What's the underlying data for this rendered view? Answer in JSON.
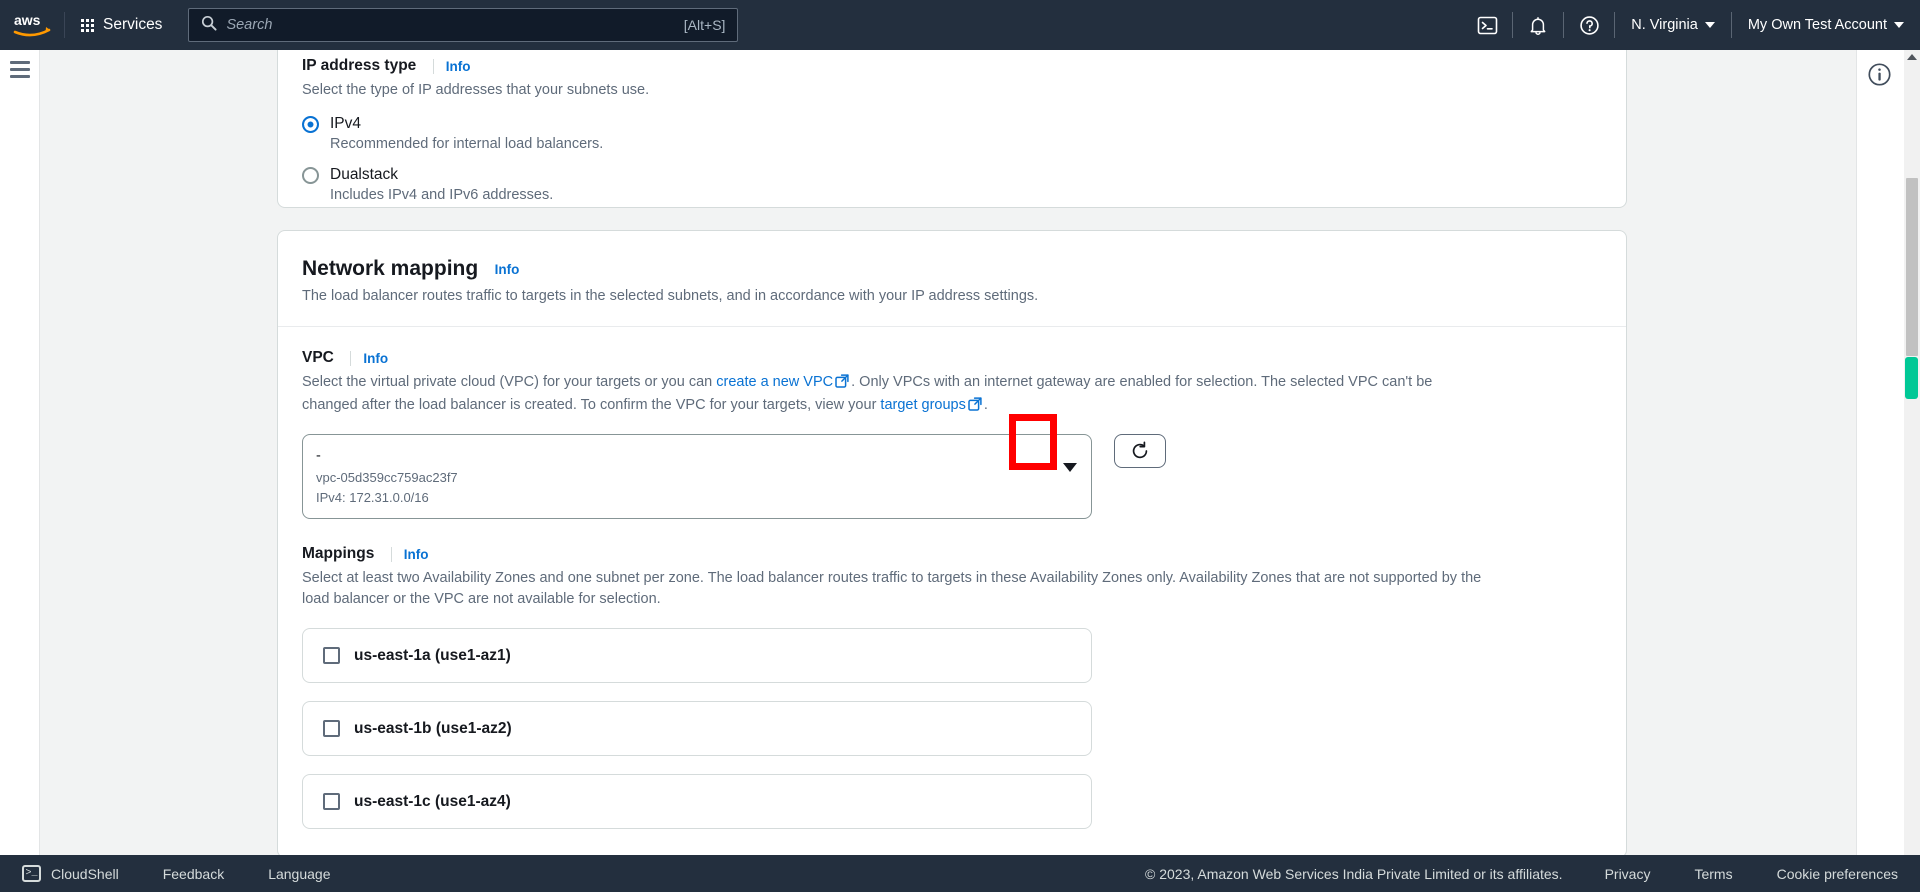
{
  "topnav": {
    "logo_alt": "aws",
    "services_label": "Services",
    "search_placeholder": "Search",
    "search_value": "",
    "search_shortcut": "[Alt+S]",
    "cloudshell_icon": "cloudshell-icon",
    "bell_icon": "notifications-icon",
    "help_icon": "help-icon",
    "region_label": "N. Virginia",
    "account_label": "My Own Test Account"
  },
  "ip_address_type": {
    "label": "IP address type",
    "info": "Info",
    "description": "Select the type of IP addresses that your subnets use.",
    "options": [
      {
        "label": "IPv4",
        "sub": "Recommended for internal load balancers.",
        "selected": true
      },
      {
        "label": "Dualstack",
        "sub": "Includes IPv4 and IPv6 addresses.",
        "selected": false
      }
    ]
  },
  "network_mapping": {
    "title": "Network mapping",
    "info": "Info",
    "description": "The load balancer routes traffic to targets in the selected subnets, and in accordance with your IP address settings.",
    "vpc": {
      "label": "VPC",
      "info": "Info",
      "desc_part1": "Select the virtual private cloud (VPC) for your targets or you can ",
      "desc_link1": "create a new VPC",
      "desc_part2": ". Only VPCs with an internet gateway are enabled for selection. The selected VPC can't be changed after the load balancer is created. To confirm the VPC for your targets, view your ",
      "desc_link2": "target groups",
      "desc_part3": ".",
      "selected_name": "-",
      "selected_id": "vpc-05d359cc759ac23f7",
      "selected_cidr": "IPv4: 172.31.0.0/16",
      "refresh_icon": "refresh-icon"
    },
    "mappings": {
      "label": "Mappings",
      "info": "Info",
      "description": "Select at least two Availability Zones and one subnet per zone. The load balancer routes traffic to targets in these Availability Zones only. Availability Zones that are not supported by the load balancer or the VPC are not available for selection.",
      "zones": [
        {
          "label": "us-east-1a (use1-az1)",
          "checked": false
        },
        {
          "label": "us-east-1b (use1-az2)",
          "checked": false
        },
        {
          "label": "us-east-1c (use1-az4)",
          "checked": false
        }
      ]
    }
  },
  "annotation": {
    "highlight_color": "#ff0000",
    "name": "red-highlight-box"
  },
  "scrollbar": {
    "marker_color": "#00c896",
    "thumb_color": "#c1c1c1"
  },
  "footer": {
    "cloudshell": "CloudShell",
    "feedback": "Feedback",
    "language": "Language",
    "copyright": "© 2023, Amazon Web Services India Private Limited or its affiliates.",
    "privacy": "Privacy",
    "terms": "Terms",
    "cookie_preferences": "Cookie preferences"
  }
}
